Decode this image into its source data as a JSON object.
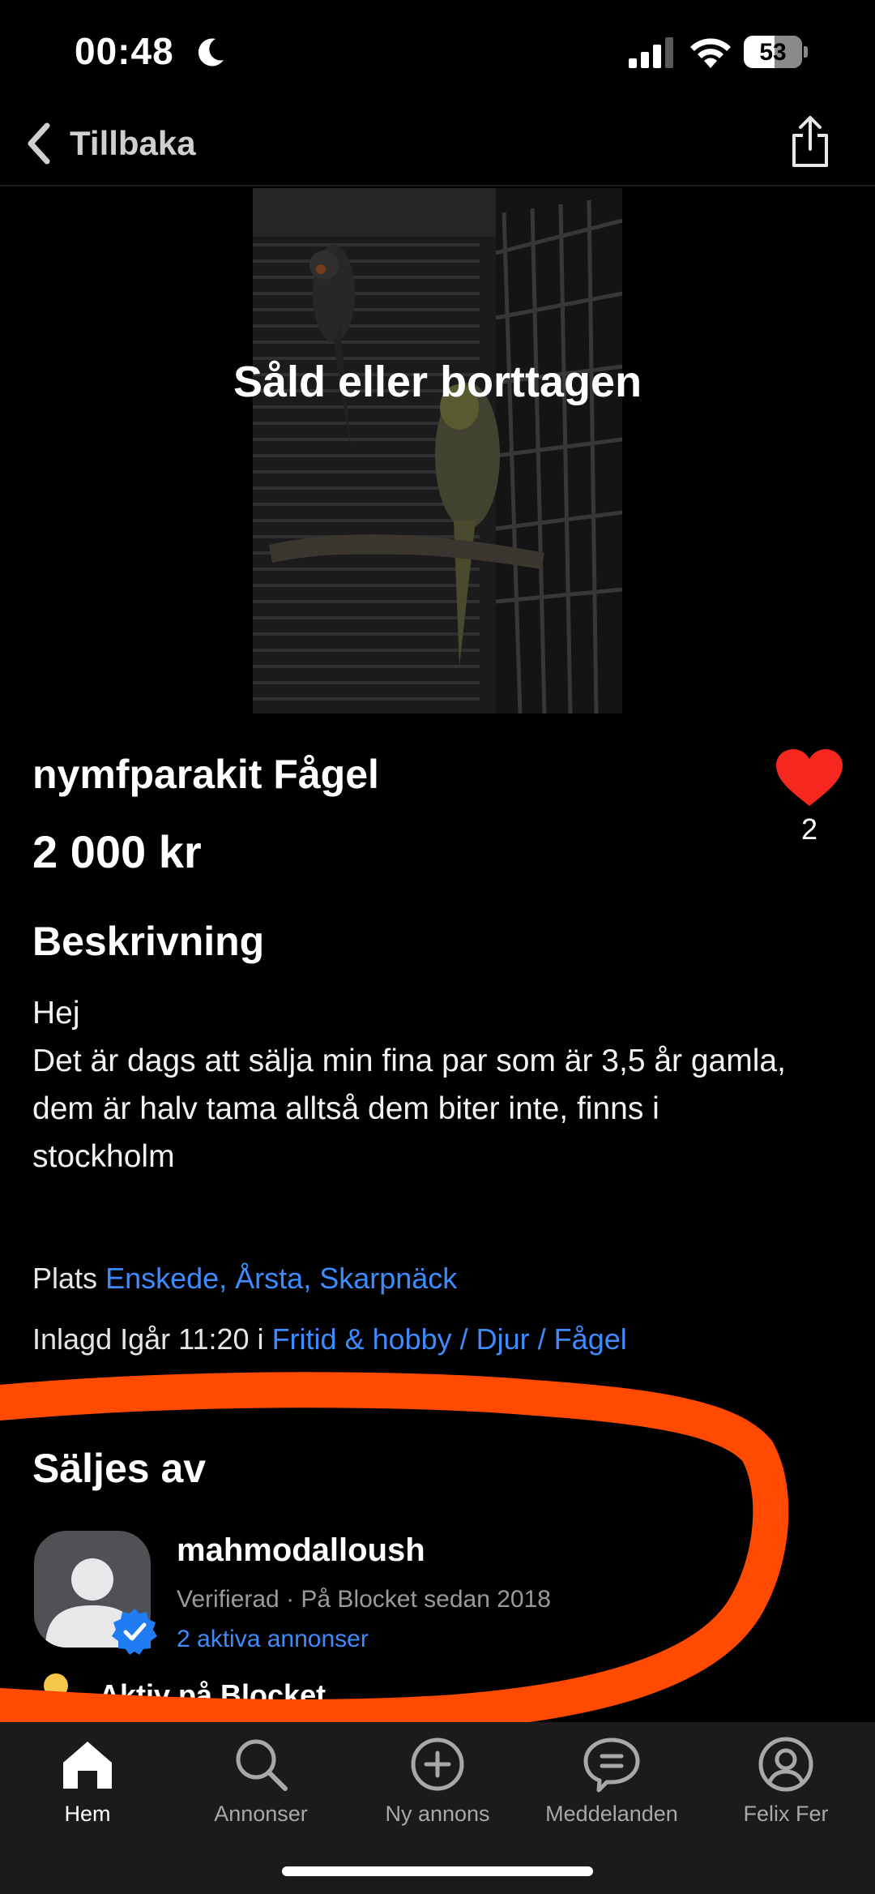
{
  "status_bar": {
    "time": "00:48",
    "battery": "53"
  },
  "nav": {
    "back_label": "Tillbaka"
  },
  "listing": {
    "sold_overlay": "Såld eller borttagen",
    "title": "nymfparakit Fågel",
    "price": "2 000 kr",
    "favorite_count": "2",
    "description_heading": "Beskrivning",
    "description_lines": [
      "Hej",
      "Det är dags att sälja min fina par som är 3,5 år gamla,",
      "dem är halv tama alltså dem biter inte, finns i",
      "stockholm"
    ],
    "location_label": "Plats",
    "location_value": "Enskede, Årsta, Skarpnäck",
    "posted_label": "Inlagd Igår 11:20 i",
    "category_path": "Fritid & hobby / Djur / Fågel"
  },
  "seller": {
    "heading": "Säljes av",
    "name": "mahmodalloush",
    "meta": "Verifierad · På Blocket sedan 2018",
    "active_ads": "2 aktiva annonser",
    "status": "Aktiv på Blocket"
  },
  "tabs": [
    {
      "label": "Hem",
      "icon": "home-icon",
      "active": true
    },
    {
      "label": "Annonser",
      "icon": "search-icon",
      "active": false
    },
    {
      "label": "Ny annons",
      "icon": "plus-circle-icon",
      "active": false
    },
    {
      "label": "Meddelanden",
      "icon": "chat-icon",
      "active": false
    },
    {
      "label": "Felix Fer",
      "icon": "profile-icon",
      "active": false
    }
  ],
  "colors": {
    "background": "#000000",
    "link": "#3d8bfd",
    "heart": "#f5271e",
    "annotation": "#ff4a00",
    "tab_bar": "#1b1b1b",
    "active_dot": "#f5c84a",
    "verified": "#1f7cf2"
  }
}
